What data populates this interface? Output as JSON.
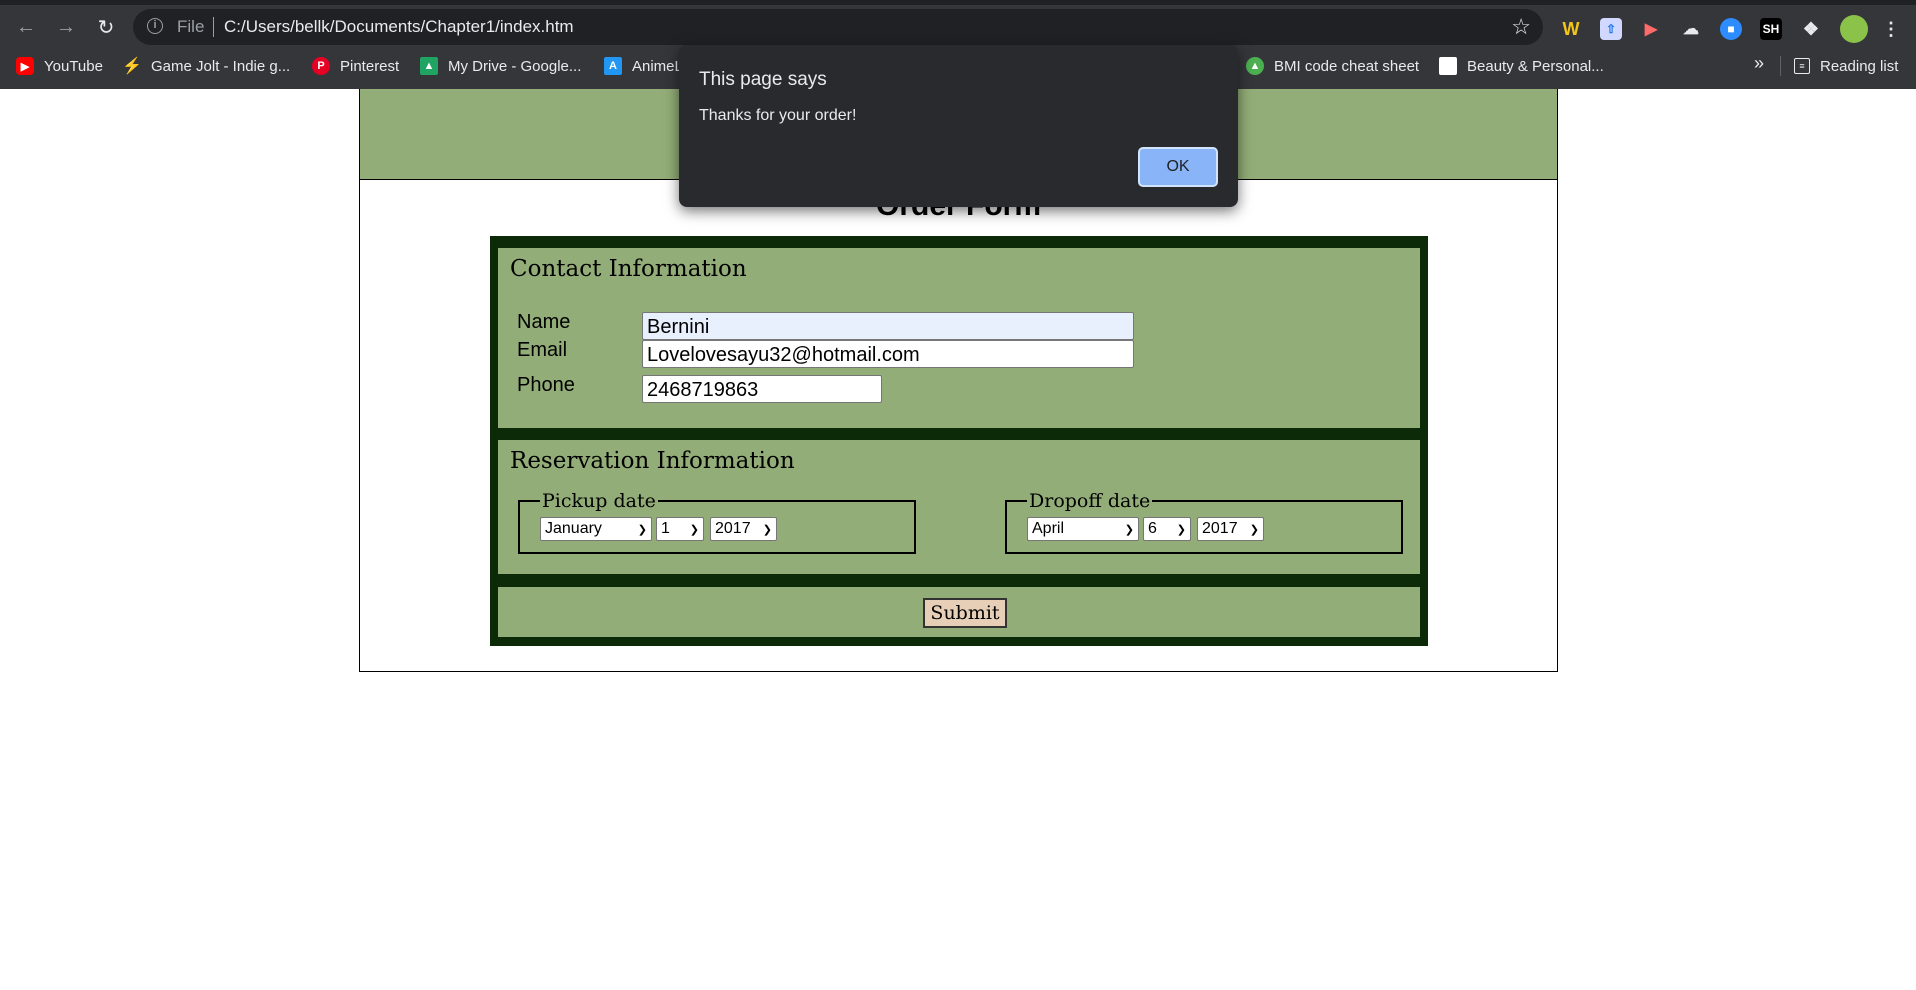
{
  "browser": {
    "address_prefix": "File",
    "url": "C:/Users/bellk/Documents/Chapter1/index.htm",
    "bookmarks": [
      {
        "label": "YouTube",
        "icon": "youtube-icon",
        "color": "#ff0000"
      },
      {
        "label": "Game Jolt - Indie g...",
        "icon": "gamejolt-icon",
        "color": "#cccccc"
      },
      {
        "label": "Pinterest",
        "icon": "pinterest-icon",
        "color": "#e60023"
      },
      {
        "label": "My Drive - Google...",
        "icon": "google-drive-icon",
        "color": "#1fa463"
      },
      {
        "label": "AnimeL",
        "icon": "anime-icon",
        "color": "#2196f3"
      },
      {
        "label": "BMI code cheat sheet",
        "icon": "bmi-icon",
        "color": "#4caf50"
      },
      {
        "label": "Beauty & Personal...",
        "icon": "beauty-icon",
        "color": "#ffffff"
      }
    ],
    "overflow": "»",
    "reading_list": "Reading list"
  },
  "page": {
    "form_title": "Order Form",
    "contact": {
      "heading": "Contact Information",
      "name_label": "Name",
      "name_value": "Bernini",
      "email_label": "Email",
      "email_value": "Lovelovesayu32@hotmail.com",
      "phone_label": "Phone",
      "phone_value": "2468719863"
    },
    "reservation": {
      "heading": "Reservation Information",
      "pickup": {
        "legend": "Pickup date",
        "month": "January",
        "day": "1",
        "year": "2017"
      },
      "dropoff": {
        "legend": "Dropoff date",
        "month": "April",
        "day": "6",
        "year": "2017"
      }
    },
    "submit_label": "Submit"
  },
  "dialog": {
    "title": "This page says",
    "message": "Thanks for your order!",
    "ok_label": "OK"
  },
  "colors": {
    "panel_green": "#93ad78",
    "form_border": "#0c2a08",
    "submit_bg": "#e6cfb6",
    "dialog_bg": "#292a2d",
    "ok_button": "#8ab4f8"
  }
}
